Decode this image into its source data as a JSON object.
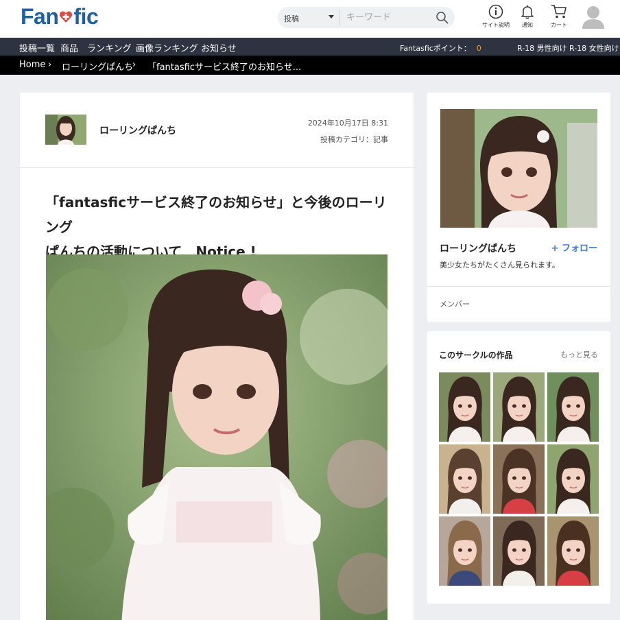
{
  "header": {
    "logo_text_left": "Fan",
    "logo_text_right": "fic",
    "search": {
      "category": "投稿",
      "placeholder": "キーワード"
    },
    "icons": [
      {
        "name": "info-icon",
        "label": "サイト説明"
      },
      {
        "name": "bell-icon",
        "label": "通知"
      },
      {
        "name": "cart-icon",
        "label": "カート"
      }
    ]
  },
  "nav": {
    "items": [
      "投稿一覧",
      "商品",
      "ランキング",
      "画像ランキング",
      "お知らせ"
    ],
    "points_label": "Fantasficポイント：",
    "points_value": "0",
    "r18_male": "R-18 男性向け",
    "r18_female": "R-18 女性向け"
  },
  "breadcrumb": {
    "items": [
      "Home",
      "ローリングぱんち",
      "「fantasficサービス終了のお知らせ..."
    ],
    "separator": "›"
  },
  "post": {
    "author": "ローリングぱんち",
    "date": "2024年10月17日 8:31",
    "category": "投稿カテゴリ：記事",
    "title_line1": "「fantasficサービス終了のお知らせ」と今後のローリング",
    "title_line2": "ぱんちの活動について　Notice !"
  },
  "profile": {
    "name": "ローリングぱんち",
    "follow_label": "+ フォロー",
    "description": "美少女たちがたくさん見られます。",
    "members_label": "メンバー"
  },
  "works": {
    "title": "このサークルの作品",
    "more_label": "もっと見る",
    "count": 9
  },
  "colors": {
    "logo": "#1f5fa8",
    "nav_bg": "#2d3340",
    "crumb_bg": "#000000",
    "accent_points": "#f0a030",
    "follow": "#3a7bd5",
    "page_bg": "#eceef1"
  }
}
